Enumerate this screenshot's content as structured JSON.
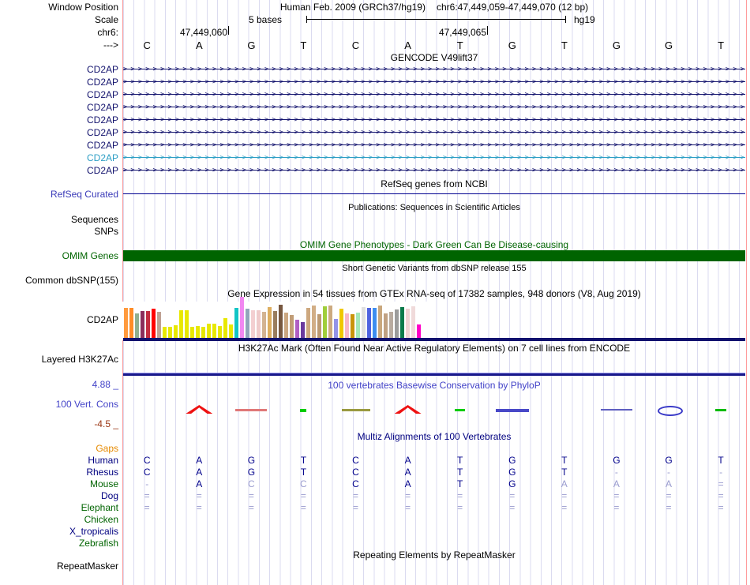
{
  "colors": {
    "grid": "#DBDBF0",
    "guide_pink": "#FF9B9B",
    "divider_navy": "#11116E",
    "gene_navy": "#14146E",
    "gene_highlight": "#2E9FC5",
    "omim_green": "#006400",
    "strong_base": "#00008B",
    "weak_base": "#9A9CCF"
  },
  "header": {
    "window_position_label": "Window Position",
    "assembly_title": "Human Feb. 2009 (GRCh37/hg19)",
    "position_title": "chr6:47,449,059-47,449,070 (12 bp)",
    "scale_label": "Scale",
    "scale_text": "5 bases",
    "genome_label": "hg19",
    "chrom_label": "chr6:",
    "coord_ticks": [
      "47,449,060",
      "47,449,065"
    ],
    "strand_label": "--->",
    "bases": [
      "C",
      "A",
      "G",
      "T",
      "C",
      "A",
      "T",
      "G",
      "T",
      "G",
      "G",
      "T"
    ]
  },
  "tracks": {
    "gencode": {
      "title": "GENCODE V49lift37",
      "genes": [
        {
          "label": "CD2AP",
          "style": "normal"
        },
        {
          "label": "CD2AP",
          "style": "normal"
        },
        {
          "label": "CD2AP",
          "style": "normal"
        },
        {
          "label": "CD2AP",
          "style": "normal"
        },
        {
          "label": "CD2AP",
          "style": "normal"
        },
        {
          "label": "CD2AP",
          "style": "normal"
        },
        {
          "label": "CD2AP",
          "style": "normal"
        },
        {
          "label": "CD2AP",
          "style": "highlight"
        },
        {
          "label": "CD2AP",
          "style": "normal"
        }
      ]
    },
    "refseq": {
      "title": "RefSeq genes from NCBI",
      "label": "RefSeq Curated"
    },
    "publications": {
      "title": "Publications: Sequences in Scientific Articles",
      "labels": [
        "Sequences",
        "SNPs"
      ]
    },
    "omim": {
      "title": "OMIM Gene Phenotypes - Dark Green Can Be Disease-causing",
      "label": "OMIM Genes"
    },
    "dbsnp": {
      "title": "Short Genetic Variants from dbSNP release 155",
      "label": "Common dbSNP(155)"
    },
    "gtex": {
      "title": "Gene Expression in 54 tissues from GTEx RNA-seq of 17382 samples, 948 donors (V8, Aug 2019)",
      "label": "CD2AP"
    },
    "h3k27ac": {
      "title": "H3K27Ac Mark (Often Found Near Active Regulatory Elements) on 7 cell lines from ENCODE",
      "label": "Layered H3K27Ac"
    },
    "conservation": {
      "title": "100 vertebrates Basewise Conservation by PhyloP",
      "label": "100 Vert. Cons",
      "max_label": "4.88 _",
      "min_label": "-4.5 _",
      "marks": [
        {
          "base": 1,
          "type": "peak",
          "color": "#EE1111",
          "w": 34,
          "h": 11
        },
        {
          "base": 2,
          "type": "dash",
          "color": "#E07878",
          "w": 40,
          "h": 3
        },
        {
          "base": 3,
          "type": "dash",
          "color": "#00CC00",
          "w": 8,
          "h": 4
        },
        {
          "base": 4,
          "type": "dash",
          "color": "#9A9A40",
          "w": 36,
          "h": 3
        },
        {
          "base": 5,
          "type": "peak",
          "color": "#EE1111",
          "w": 34,
          "h": 11
        },
        {
          "base": 6,
          "type": "dash",
          "color": "#00CC00",
          "w": 13,
          "h": 3
        },
        {
          "base": 7,
          "type": "dash",
          "color": "#4949C8",
          "w": 42,
          "h": 4
        },
        {
          "base": 9,
          "type": "dash",
          "color": "#5E5EC0",
          "w": 40,
          "h": 2
        },
        {
          "base": 10,
          "type": "oval",
          "color": "#3A3AC8",
          "w": 28,
          "h": 9
        },
        {
          "base": 11,
          "type": "dash",
          "color": "#00BB00",
          "w": 14,
          "h": 3
        }
      ]
    },
    "multiz": {
      "title": "Multiz Alignments of 100 Vertebrates",
      "gaps_label": "Gaps",
      "rows": [
        {
          "name": "Human",
          "name_color": "#000080",
          "cells": [
            [
              "C",
              1
            ],
            [
              "A",
              1
            ],
            [
              "G",
              1
            ],
            [
              "T",
              1
            ],
            [
              "C",
              1
            ],
            [
              "A",
              1
            ],
            [
              "T",
              1
            ],
            [
              "G",
              1
            ],
            [
              "T",
              1
            ],
            [
              "G",
              1
            ],
            [
              "G",
              1
            ],
            [
              "T",
              1
            ]
          ]
        },
        {
          "name": "Rhesus",
          "name_color": "#000080",
          "cells": [
            [
              "C",
              1
            ],
            [
              "A",
              1
            ],
            [
              "G",
              1
            ],
            [
              "T",
              1
            ],
            [
              "C",
              1
            ],
            [
              "A",
              1
            ],
            [
              "T",
              1
            ],
            [
              "G",
              1
            ],
            [
              "T",
              1
            ],
            [
              "-",
              0
            ],
            [
              "-",
              0
            ],
            [
              "-",
              0
            ]
          ]
        },
        {
          "name": "Mouse",
          "name_color": "#006400",
          "cells": [
            [
              "-",
              0
            ],
            [
              "A",
              1
            ],
            [
              "C",
              0
            ],
            [
              "C",
              0
            ],
            [
              "C",
              1
            ],
            [
              "A",
              1
            ],
            [
              "T",
              1
            ],
            [
              "G",
              1
            ],
            [
              "A",
              0
            ],
            [
              "A",
              0
            ],
            [
              "A",
              0
            ],
            [
              "=",
              0
            ]
          ]
        },
        {
          "name": "Dog",
          "name_color": "#000080",
          "cells": [
            [
              "=",
              0
            ],
            [
              "=",
              0
            ],
            [
              "=",
              0
            ],
            [
              "=",
              0
            ],
            [
              "=",
              0
            ],
            [
              "=",
              0
            ],
            [
              "=",
              0
            ],
            [
              "=",
              0
            ],
            [
              "=",
              0
            ],
            [
              "=",
              0
            ],
            [
              "=",
              0
            ],
            [
              "=",
              0
            ]
          ]
        },
        {
          "name": "Elephant",
          "name_color": "#006400",
          "cells": [
            [
              "=",
              0
            ],
            [
              "=",
              0
            ],
            [
              "=",
              0
            ],
            [
              "=",
              0
            ],
            [
              "=",
              0
            ],
            [
              "=",
              0
            ],
            [
              "=",
              0
            ],
            [
              "=",
              0
            ],
            [
              "=",
              0
            ],
            [
              "=",
              0
            ],
            [
              "=",
              0
            ],
            [
              "=",
              0
            ]
          ]
        },
        {
          "name": "Chicken",
          "name_color": "#006400",
          "cells": []
        },
        {
          "name": "X_tropicalis",
          "name_color": "#000080",
          "cells": []
        },
        {
          "name": "Zebrafish",
          "name_color": "#006400",
          "cells": []
        }
      ]
    },
    "repeatmasker": {
      "title": "Repeating Elements by RepeatMasker",
      "label": "RepeatMasker"
    }
  },
  "chart_data": {
    "type": "bar",
    "title": "Gene Expression in 54 tissues from GTEx RNA-seq of 17382 samples, 948 donors (V8, Aug 2019)",
    "gene": "CD2AP",
    "ylabel": "relative expression (bar height, px, no axis shown)",
    "values": [
      38,
      38,
      31,
      34,
      34,
      37,
      33,
      14,
      14,
      16,
      35,
      35,
      14,
      15,
      14,
      18,
      18,
      15,
      25,
      17,
      38,
      52,
      37,
      35,
      35,
      33,
      39,
      34,
      42,
      32,
      29,
      23,
      20,
      38,
      41,
      30,
      40,
      41,
      24,
      37,
      31,
      30,
      32,
      39,
      38,
      38,
      41,
      31,
      33,
      36,
      39,
      37,
      40,
      17
    ],
    "colors": [
      "#FF9A3D",
      "#FF8C26",
      "#8FAF8F",
      "#8B2E5C",
      "#C22D41",
      "#FF0000",
      "#BFA193",
      "#E8E800",
      "#E8E800",
      "#E8E800",
      "#E8E800",
      "#E8E800",
      "#E8E800",
      "#E8E800",
      "#E8E800",
      "#E8E800",
      "#E8E800",
      "#E8E800",
      "#E8E800",
      "#E8E800",
      "#12C5C5",
      "#F187F1",
      "#92A5BB",
      "#F3CFD1",
      "#EFCBCB",
      "#D3B391",
      "#DDAE5F",
      "#9A7D5E",
      "#77573F",
      "#CBA781",
      "#C19D77",
      "#B05FC4",
      "#6A3A9E",
      "#CDA87F",
      "#D2AE86",
      "#BD9A72",
      "#A0CE3B",
      "#CCAA80",
      "#9393E8",
      "#F0C800",
      "#F8B7C8",
      "#C9940B",
      "#A5E8B8",
      "#DFDFDF",
      "#4E62E0",
      "#3E8EF0",
      "#C9A77D",
      "#C0A183",
      "#B8ABA0",
      "#9C9C9C",
      "#0A7A4A",
      "#EFD3D3",
      "#F0DADA",
      "#FF00C8"
    ]
  }
}
